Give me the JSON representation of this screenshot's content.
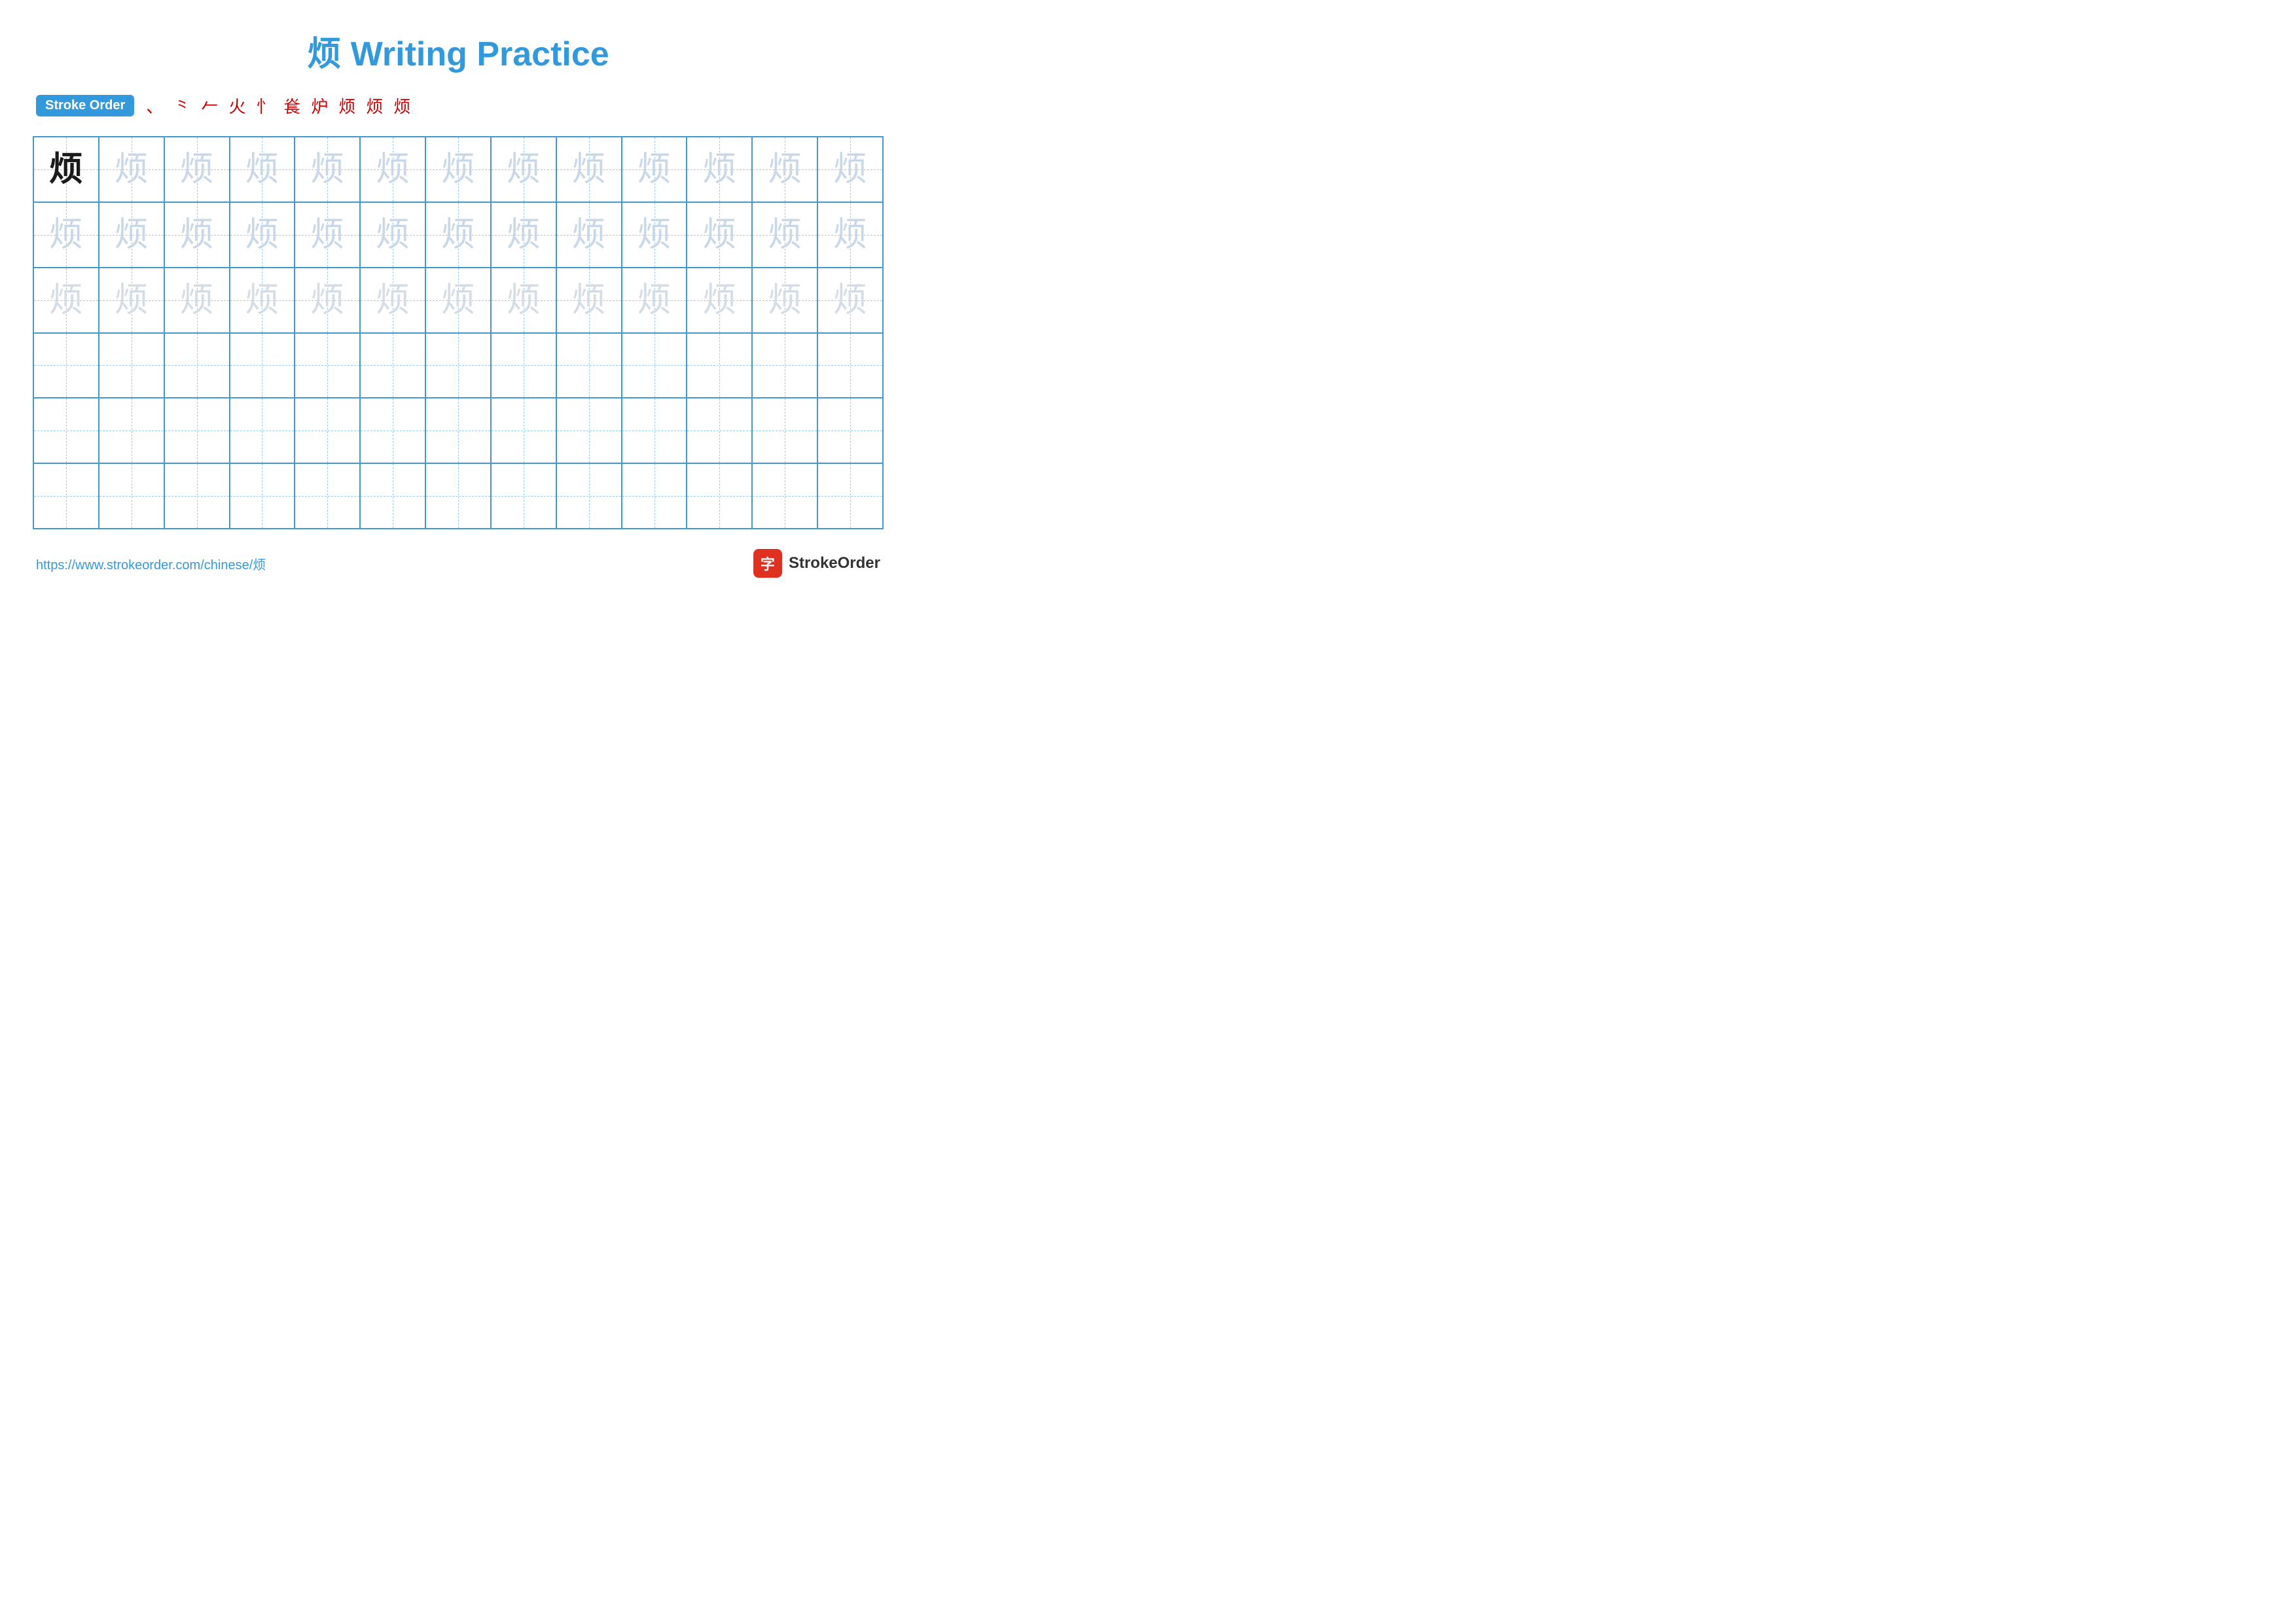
{
  "title": "烦 Writing Practice",
  "stroke_order": {
    "badge_label": "Stroke Order",
    "steps": [
      "、",
      "⺀",
      "𠂉",
      "火",
      "忄",
      "㷃",
      "㷃+",
      "烦-",
      "烦",
      "烦"
    ]
  },
  "character": "烦",
  "grid": {
    "rows": 6,
    "cols": 13,
    "row_types": [
      "model_light",
      "light",
      "lighter",
      "empty",
      "empty",
      "empty"
    ]
  },
  "footer": {
    "url": "https://www.strokeorder.com/chinese/烦",
    "logo_icon": "字",
    "logo_text": "StrokeOrder"
  }
}
